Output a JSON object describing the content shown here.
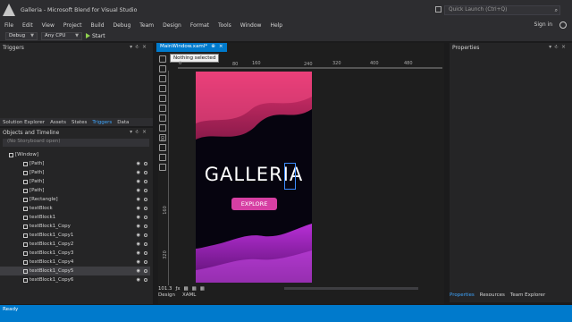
{
  "title_bar": {
    "text": "Galleria - Microsoft Blend for Visual Studio",
    "quick_launch_placeholder": "Quick Launch (Ctrl+Q)"
  },
  "menu": [
    "File",
    "Edit",
    "View",
    "Project",
    "Build",
    "Debug",
    "Team",
    "Design",
    "Format",
    "Tools",
    "Window",
    "Help"
  ],
  "account": {
    "sign_in": "Sign in"
  },
  "toolbar": {
    "config": "Debug",
    "platform": "Any CPU",
    "start": "Start"
  },
  "triggers_panel": {
    "title": "Triggers"
  },
  "left_tabs": [
    "Solution Explorer",
    "Assets",
    "States",
    "Triggers",
    "Data"
  ],
  "objects_panel": {
    "title": "Objects and Timeline",
    "storyboard": "(No Storyboard open)"
  },
  "tree": [
    "[Window]",
    "[Path]",
    "[Path]",
    "[Path]",
    "[Path]",
    "[Rectangle]",
    "textBlock",
    "textBlock1",
    "textBlock1_Copy",
    "textBlock1_Copy1",
    "textBlock1_Copy2",
    "textBlock1_Copy3",
    "textBlock1_Copy4",
    "textBlock1_Copy5",
    "textBlock1_Copy6"
  ],
  "document": {
    "tab_label": "MainWindow.xaml*",
    "tab_pin": "⊕",
    "tab_close": "×",
    "tooltip": "Nothing selected",
    "ruler_h": [
      "0",
      "80",
      "160",
      "240",
      "320",
      "400",
      "480"
    ],
    "ruler_v": [
      "80",
      "160",
      "240",
      "320",
      "400"
    ],
    "zoom": "101.3",
    "view_tabs": {
      "design": "Design",
      "xaml": "XAML"
    }
  },
  "artboard": {
    "heading": "GALLERIA",
    "button": "EXPLORE"
  },
  "properties_panel": {
    "title": "Properties",
    "bottom_tabs": [
      "Properties",
      "Resources",
      "Team Explorer"
    ]
  },
  "status": {
    "text": "Ready"
  },
  "colors": {
    "accent": "#007acc",
    "button_pink": "#d63fa3",
    "wave_top": "#e2336f",
    "wave_bottom": "#b72fd6"
  }
}
